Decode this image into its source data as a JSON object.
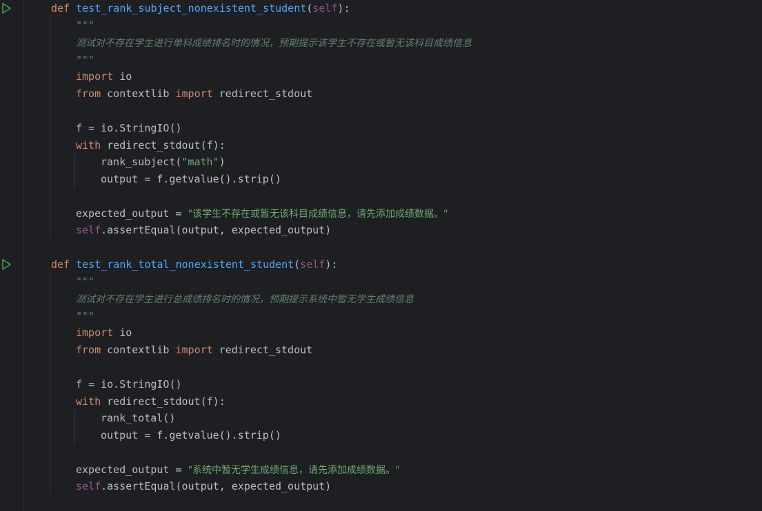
{
  "colors": {
    "background": "#1e1f22",
    "keyword": "#cf8e6d",
    "function": "#56a8f5",
    "self": "#94558d",
    "string": "#6aab73",
    "docstring": "#5f826b",
    "text": "#bcbec4",
    "run_icon": "#499c54"
  },
  "gutter": {
    "run_icons": [
      "run-icon",
      "run-icon"
    ]
  },
  "code": {
    "kw_def": "def",
    "kw_import": "import",
    "kw_from": "from",
    "kw_with": "with",
    "self": "self",
    "triple_quote": "\"\"\"",
    "func1": {
      "name": "test_rank_subject_nonexistent_student",
      "docstring": "测试对不存在学生进行单科成绩排名时的情况，预期提示该学生不存在或暂无该科目成绩信息",
      "call_name": "rank_subject(",
      "call_arg": "\"math\"",
      "call_close": ")",
      "expected_str": "\"该学生不存在或暂无该科目成绩信息，请先添加成绩数据。\""
    },
    "func2": {
      "name": "test_rank_total_nonexistent_student",
      "docstring": "测试对不存在学生进行总成绩排名时的情况，预期提示系统中暂无学生成绩信息",
      "call": "rank_total()",
      "expected_str": "\"系统中暂无学生成绩信息，请先添加成绩数据。\""
    },
    "common": {
      "params_open": "(",
      "params_close": "):",
      "io": " io",
      "contextlib": " contextlib ",
      "redirect_stdout": " redirect_stdout",
      "f_assign": "f = io.StringIO()",
      "with_rest": " redirect_stdout(f):",
      "output_assign": "output = f.getvalue().strip()",
      "expected_assign": "expected_output = ",
      "assert_rest": ".assertEqual(output, expected_output)"
    }
  }
}
